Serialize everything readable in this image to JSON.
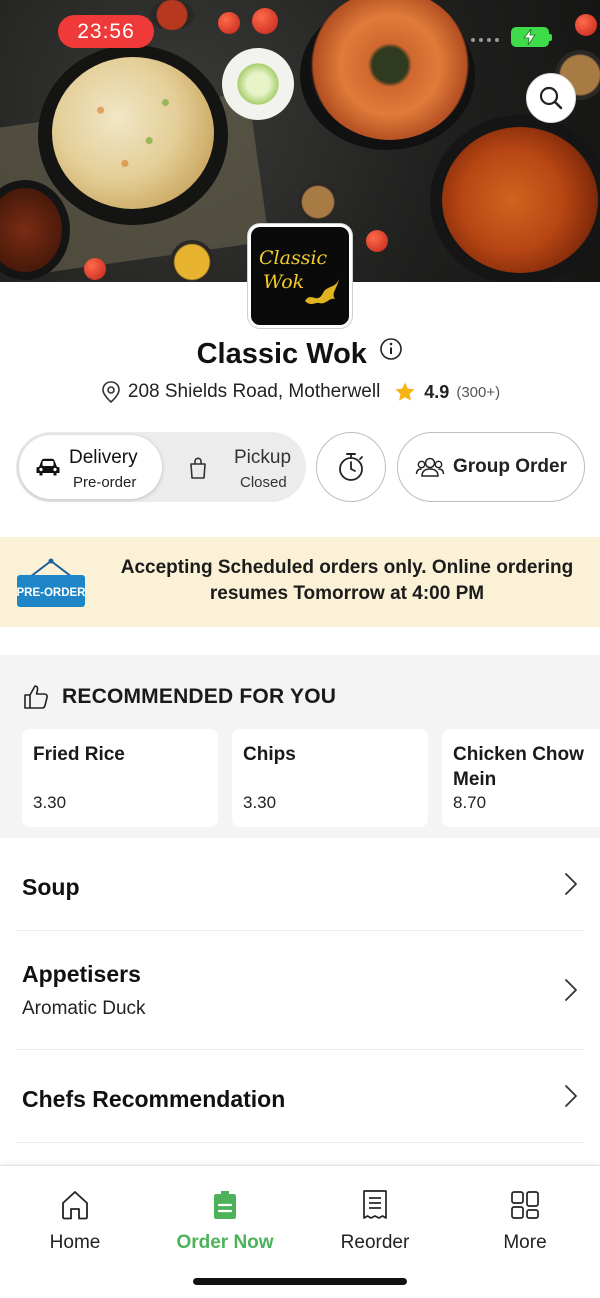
{
  "status_bar": {
    "time": "23:56",
    "battery_icon": "charging-battery-icon",
    "battery_color": "#3fdc4a",
    "time_pill_color": "#f03a3a"
  },
  "restaurant": {
    "logo_line1": "Classic",
    "logo_line2": "Wok",
    "name": "Classic Wok",
    "address": "208 Shields Road, Motherwell",
    "rating": "4.9",
    "rating_count": "(300+)"
  },
  "order_modes": {
    "delivery": {
      "label": "Delivery",
      "sub": "Pre-order"
    },
    "pickup": {
      "label": "Pickup",
      "sub": "Closed"
    },
    "group_order_label": "Group Order"
  },
  "banner": {
    "badge": "PRE-ORDER",
    "message": "Accepting Scheduled orders only. Online ordering resumes Tomorrow at 4:00 PM",
    "background": "#fbf1d6"
  },
  "recommended": {
    "title": "RECOMMENDED FOR YOU",
    "items": [
      {
        "name": "Fried Rice",
        "price": "3.30"
      },
      {
        "name": "Chips",
        "price": "3.30"
      },
      {
        "name": "Chicken Chow Mein",
        "price": "8.70"
      }
    ]
  },
  "categories": [
    {
      "name": "Soup",
      "subtitle": ""
    },
    {
      "name": "Appetisers",
      "subtitle": "Aromatic Duck"
    },
    {
      "name": "Chefs Recommendation",
      "subtitle": ""
    }
  ],
  "bottom_nav": {
    "items": [
      {
        "label": "Home",
        "icon": "home-icon"
      },
      {
        "label": "Order Now",
        "icon": "order-icon"
      },
      {
        "label": "Reorder",
        "icon": "receipt-icon"
      },
      {
        "label": "More",
        "icon": "grid-icon"
      }
    ],
    "active_index": 1,
    "accent": "#4cb35a"
  }
}
